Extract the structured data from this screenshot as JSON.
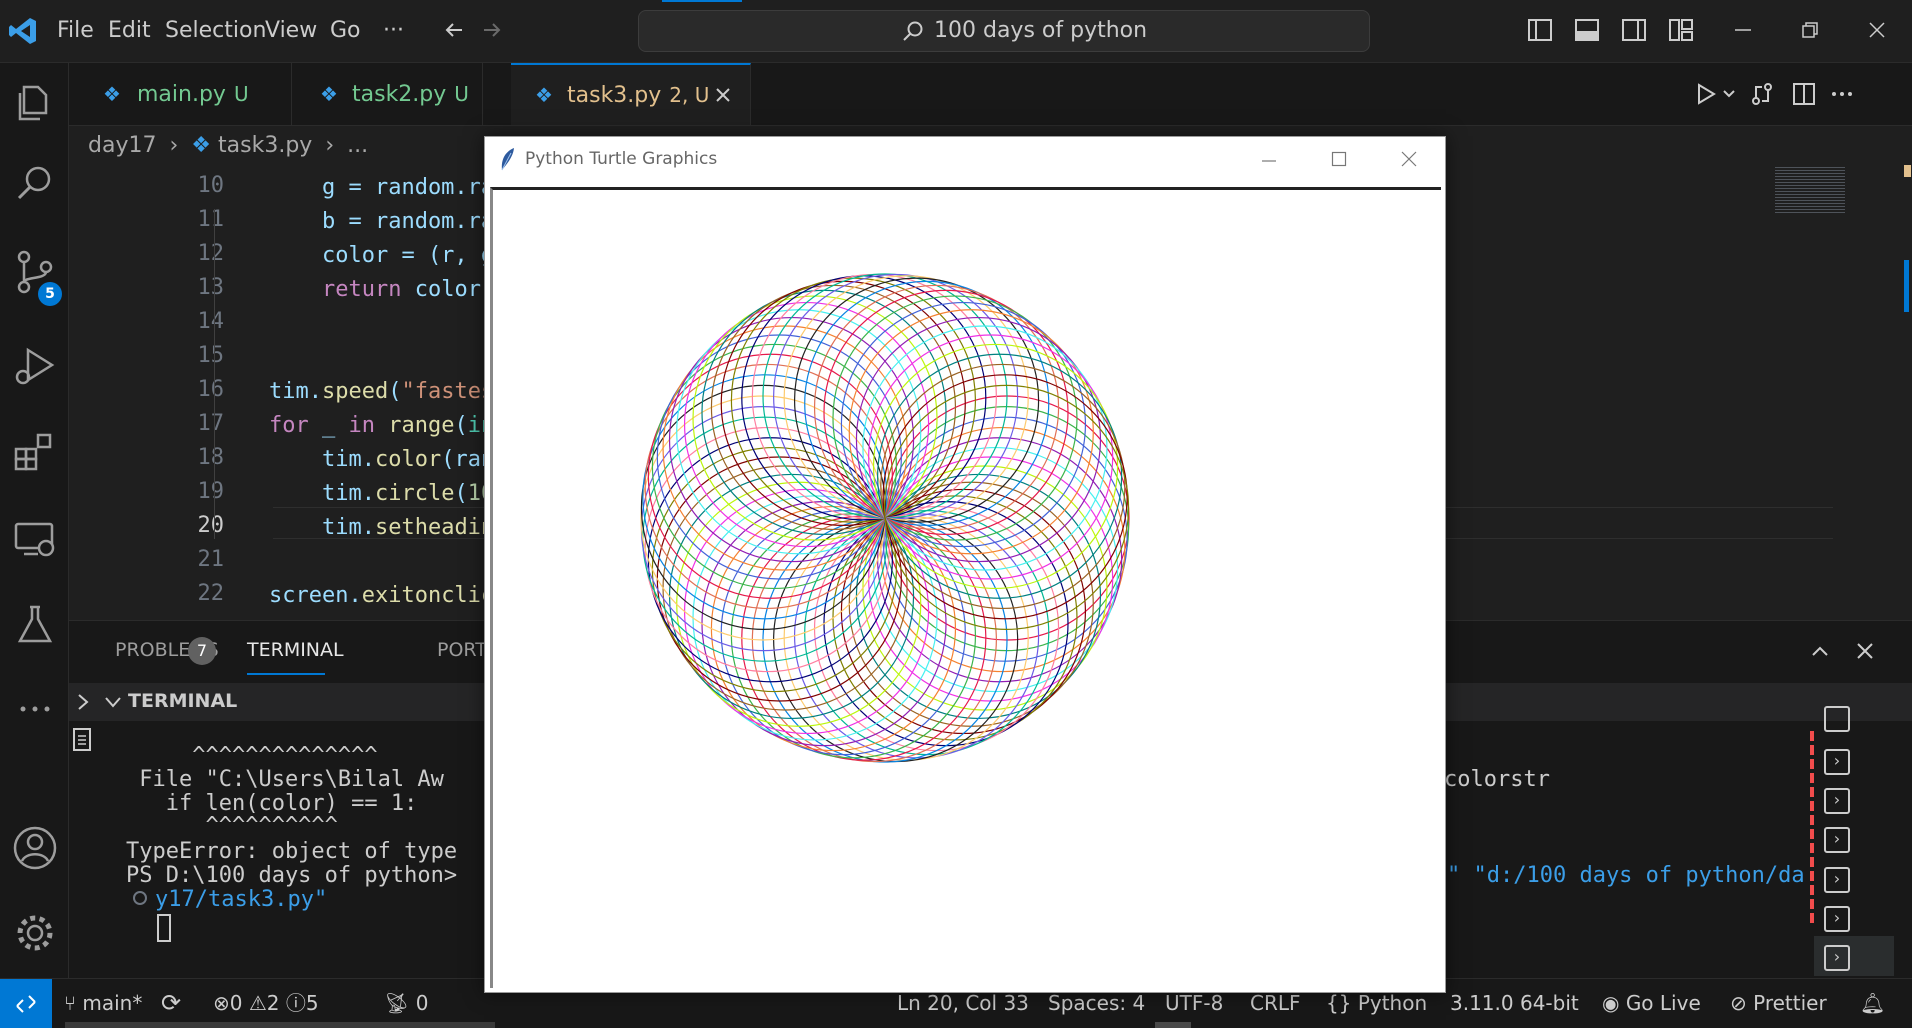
{
  "menu": [
    "File",
    "Edit",
    "Selection",
    "View",
    "Go",
    "···"
  ],
  "command_center": {
    "text": "100 days of python"
  },
  "activity": {
    "scm_badge": "5"
  },
  "tabs": [
    {
      "name": "main.py",
      "status": "U"
    },
    {
      "name": "task2.py",
      "status": "U"
    },
    {
      "name": "task3.py",
      "status": "2, U"
    }
  ],
  "breadcrumb": {
    "folder": "day17",
    "file": "task3.py",
    "more": "..."
  },
  "editor": {
    "line_numbers": [
      "10",
      "11",
      "12",
      "13",
      "14",
      "15",
      "16",
      "17",
      "18",
      "19",
      "20",
      "21",
      "22"
    ]
  },
  "panel": {
    "problems_label": "PROBLEMS",
    "problems_count": "7",
    "terminal_label": "TERMINAL",
    "ports_label": "PORT",
    "section_title": "TERMINAL",
    "lines": [
      "     ^^^^^^^^^^^^^^",
      " File \"C:\\Users\\Bilal Aw",
      "   if len(color) == 1:",
      "      ^^^^^^^^^^",
      "TypeError: object of type",
      "PS D:\\100 days of python>",
      "y17/task3.py\""
    ],
    "right_fragment_1": "colorstr",
    "right_fragment_2": "\" \"d:/100 days of python/da"
  },
  "status": {
    "branch": "main*",
    "errors": "0",
    "warnings": "2",
    "infos": "5",
    "ports": "0",
    "position": "Ln 20, Col 33",
    "spaces": "Spaces: 4",
    "encoding": "UTF-8",
    "eol": "CRLF",
    "language": "Python",
    "interpreter": "3.11.0 64-bit",
    "golive": "Go Live",
    "prettier": "Prettier"
  },
  "turtle": {
    "title": "Python Turtle Graphics",
    "circle_count": 72
  },
  "colors": {
    "accent": "#0078d4",
    "modified": "#73c991",
    "warning": "#e2c08d"
  }
}
